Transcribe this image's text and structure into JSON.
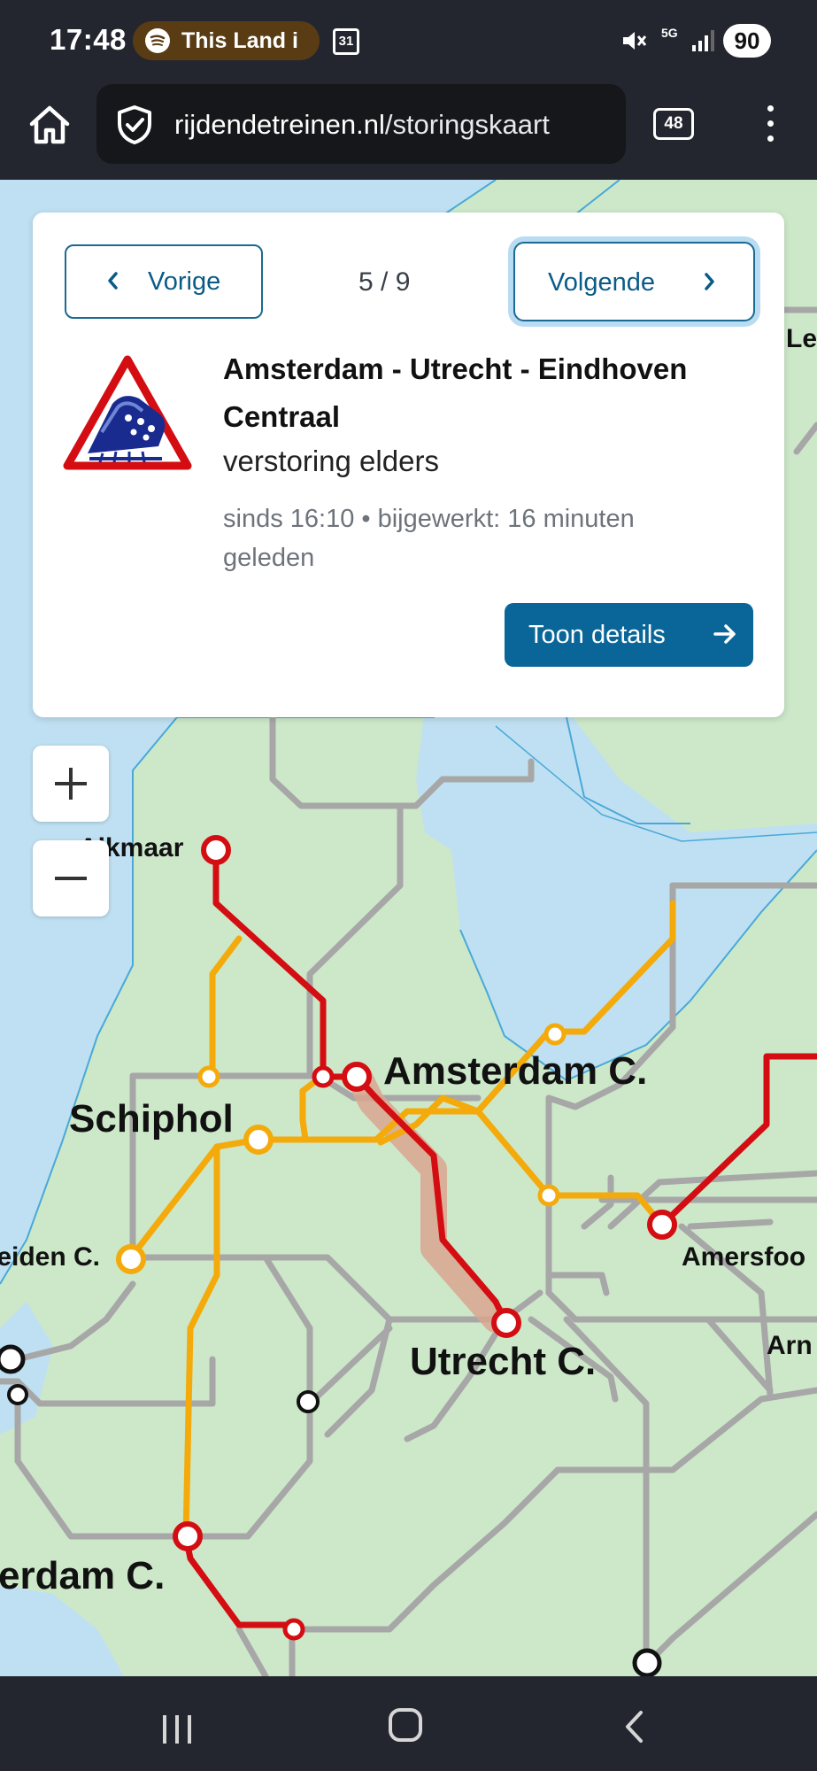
{
  "status_bar": {
    "time": "17:48",
    "media_text": "This Land i",
    "calendar_day": "31",
    "network": "5G",
    "battery": "90"
  },
  "browser": {
    "url_host": "rijdendetreinen.nl",
    "url_path": "/storingskaart",
    "tab_count": "48"
  },
  "disruption_card": {
    "prev_label": "Vorige",
    "next_label": "Volgende",
    "pager": "5 / 9",
    "title": "Amsterdam - Utrecht - Eindhoven Centraal",
    "status": "verstoring elders",
    "meta": "sinds 16:10 • bijgewerkt: 16 minuten geleden",
    "details_label": "Toon details",
    "icon": "train-disruption-warning-icon"
  },
  "map": {
    "labels": {
      "alkmaar": "Alkmaar",
      "amsterdam": "Amsterdam C.",
      "schiphol": "Schiphol",
      "leiden": "Leiden C.",
      "amersfoort": "Amersfoo",
      "utrecht": "Utrecht C.",
      "arnhem": "Arn",
      "rotterdam": "erdam C.",
      "lelystad": "Le"
    },
    "colors": {
      "land": "#cce8c9",
      "water": "#bfe0f2",
      "rail": "#a7a7a7",
      "disrupted": "#d40d12",
      "affected": "#f4aa0a",
      "highlight": "#d9a58f"
    }
  },
  "zoom": {
    "in_icon": "plus-icon",
    "out_icon": "minus-icon"
  },
  "nav": {
    "recents": "recents-icon",
    "home": "home-icon",
    "back": "back-icon"
  }
}
